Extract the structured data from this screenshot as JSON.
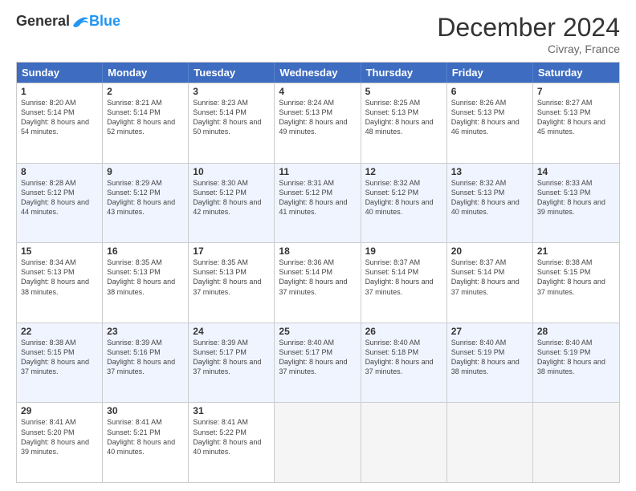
{
  "header": {
    "logo_general": "General",
    "logo_blue": "Blue",
    "month_title": "December 2024",
    "location": "Civray, France"
  },
  "days_of_week": [
    "Sunday",
    "Monday",
    "Tuesday",
    "Wednesday",
    "Thursday",
    "Friday",
    "Saturday"
  ],
  "weeks": [
    [
      {
        "day": "1",
        "sunrise": "Sunrise: 8:20 AM",
        "sunset": "Sunset: 5:14 PM",
        "daylight": "Daylight: 8 hours and 54 minutes."
      },
      {
        "day": "2",
        "sunrise": "Sunrise: 8:21 AM",
        "sunset": "Sunset: 5:14 PM",
        "daylight": "Daylight: 8 hours and 52 minutes."
      },
      {
        "day": "3",
        "sunrise": "Sunrise: 8:23 AM",
        "sunset": "Sunset: 5:14 PM",
        "daylight": "Daylight: 8 hours and 50 minutes."
      },
      {
        "day": "4",
        "sunrise": "Sunrise: 8:24 AM",
        "sunset": "Sunset: 5:13 PM",
        "daylight": "Daylight: 8 hours and 49 minutes."
      },
      {
        "day": "5",
        "sunrise": "Sunrise: 8:25 AM",
        "sunset": "Sunset: 5:13 PM",
        "daylight": "Daylight: 8 hours and 48 minutes."
      },
      {
        "day": "6",
        "sunrise": "Sunrise: 8:26 AM",
        "sunset": "Sunset: 5:13 PM",
        "daylight": "Daylight: 8 hours and 46 minutes."
      },
      {
        "day": "7",
        "sunrise": "Sunrise: 8:27 AM",
        "sunset": "Sunset: 5:13 PM",
        "daylight": "Daylight: 8 hours and 45 minutes."
      }
    ],
    [
      {
        "day": "8",
        "sunrise": "Sunrise: 8:28 AM",
        "sunset": "Sunset: 5:12 PM",
        "daylight": "Daylight: 8 hours and 44 minutes."
      },
      {
        "day": "9",
        "sunrise": "Sunrise: 8:29 AM",
        "sunset": "Sunset: 5:12 PM",
        "daylight": "Daylight: 8 hours and 43 minutes."
      },
      {
        "day": "10",
        "sunrise": "Sunrise: 8:30 AM",
        "sunset": "Sunset: 5:12 PM",
        "daylight": "Daylight: 8 hours and 42 minutes."
      },
      {
        "day": "11",
        "sunrise": "Sunrise: 8:31 AM",
        "sunset": "Sunset: 5:12 PM",
        "daylight": "Daylight: 8 hours and 41 minutes."
      },
      {
        "day": "12",
        "sunrise": "Sunrise: 8:32 AM",
        "sunset": "Sunset: 5:12 PM",
        "daylight": "Daylight: 8 hours and 40 minutes."
      },
      {
        "day": "13",
        "sunrise": "Sunrise: 8:32 AM",
        "sunset": "Sunset: 5:13 PM",
        "daylight": "Daylight: 8 hours and 40 minutes."
      },
      {
        "day": "14",
        "sunrise": "Sunrise: 8:33 AM",
        "sunset": "Sunset: 5:13 PM",
        "daylight": "Daylight: 8 hours and 39 minutes."
      }
    ],
    [
      {
        "day": "15",
        "sunrise": "Sunrise: 8:34 AM",
        "sunset": "Sunset: 5:13 PM",
        "daylight": "Daylight: 8 hours and 38 minutes."
      },
      {
        "day": "16",
        "sunrise": "Sunrise: 8:35 AM",
        "sunset": "Sunset: 5:13 PM",
        "daylight": "Daylight: 8 hours and 38 minutes."
      },
      {
        "day": "17",
        "sunrise": "Sunrise: 8:35 AM",
        "sunset": "Sunset: 5:13 PM",
        "daylight": "Daylight: 8 hours and 37 minutes."
      },
      {
        "day": "18",
        "sunrise": "Sunrise: 8:36 AM",
        "sunset": "Sunset: 5:14 PM",
        "daylight": "Daylight: 8 hours and 37 minutes."
      },
      {
        "day": "19",
        "sunrise": "Sunrise: 8:37 AM",
        "sunset": "Sunset: 5:14 PM",
        "daylight": "Daylight: 8 hours and 37 minutes."
      },
      {
        "day": "20",
        "sunrise": "Sunrise: 8:37 AM",
        "sunset": "Sunset: 5:14 PM",
        "daylight": "Daylight: 8 hours and 37 minutes."
      },
      {
        "day": "21",
        "sunrise": "Sunrise: 8:38 AM",
        "sunset": "Sunset: 5:15 PM",
        "daylight": "Daylight: 8 hours and 37 minutes."
      }
    ],
    [
      {
        "day": "22",
        "sunrise": "Sunrise: 8:38 AM",
        "sunset": "Sunset: 5:15 PM",
        "daylight": "Daylight: 8 hours and 37 minutes."
      },
      {
        "day": "23",
        "sunrise": "Sunrise: 8:39 AM",
        "sunset": "Sunset: 5:16 PM",
        "daylight": "Daylight: 8 hours and 37 minutes."
      },
      {
        "day": "24",
        "sunrise": "Sunrise: 8:39 AM",
        "sunset": "Sunset: 5:17 PM",
        "daylight": "Daylight: 8 hours and 37 minutes."
      },
      {
        "day": "25",
        "sunrise": "Sunrise: 8:40 AM",
        "sunset": "Sunset: 5:17 PM",
        "daylight": "Daylight: 8 hours and 37 minutes."
      },
      {
        "day": "26",
        "sunrise": "Sunrise: 8:40 AM",
        "sunset": "Sunset: 5:18 PM",
        "daylight": "Daylight: 8 hours and 37 minutes."
      },
      {
        "day": "27",
        "sunrise": "Sunrise: 8:40 AM",
        "sunset": "Sunset: 5:19 PM",
        "daylight": "Daylight: 8 hours and 38 minutes."
      },
      {
        "day": "28",
        "sunrise": "Sunrise: 8:40 AM",
        "sunset": "Sunset: 5:19 PM",
        "daylight": "Daylight: 8 hours and 38 minutes."
      }
    ],
    [
      {
        "day": "29",
        "sunrise": "Sunrise: 8:41 AM",
        "sunset": "Sunset: 5:20 PM",
        "daylight": "Daylight: 8 hours and 39 minutes."
      },
      {
        "day": "30",
        "sunrise": "Sunrise: 8:41 AM",
        "sunset": "Sunset: 5:21 PM",
        "daylight": "Daylight: 8 hours and 40 minutes."
      },
      {
        "day": "31",
        "sunrise": "Sunrise: 8:41 AM",
        "sunset": "Sunset: 5:22 PM",
        "daylight": "Daylight: 8 hours and 40 minutes."
      },
      null,
      null,
      null,
      null
    ]
  ]
}
